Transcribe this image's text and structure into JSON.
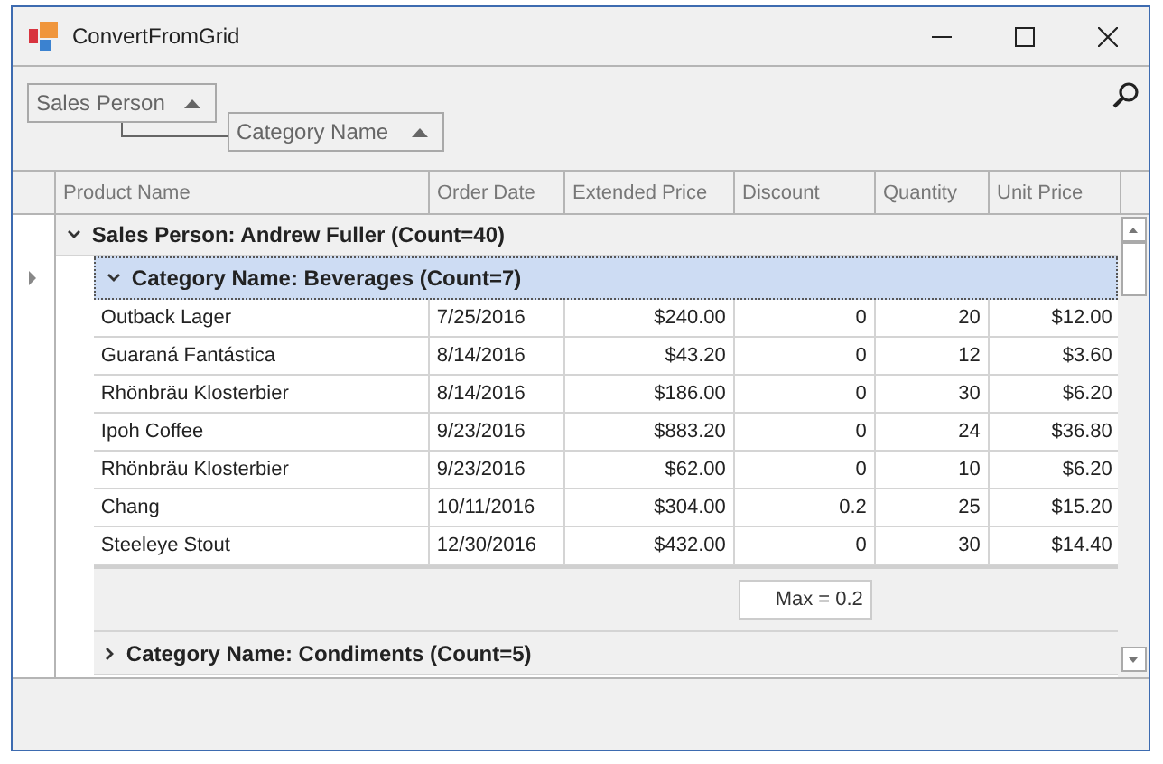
{
  "window": {
    "title": "ConvertFromGrid"
  },
  "group_panel": [
    {
      "label": "Sales Person"
    },
    {
      "label": "Category Name"
    }
  ],
  "columns": [
    {
      "label": "Product Name"
    },
    {
      "label": "Order Date"
    },
    {
      "label": "Extended Price"
    },
    {
      "label": "Discount"
    },
    {
      "label": "Quantity"
    },
    {
      "label": "Unit Price"
    }
  ],
  "groups": [
    {
      "label": "Sales Person: Andrew Fuller (Count=40)",
      "expanded": true,
      "children": [
        {
          "label": "Category Name: Beverages (Count=7)",
          "expanded": true,
          "selected": true,
          "rows": [
            [
              "Outback Lager",
              "7/25/2016",
              "$240.00",
              "0",
              "20",
              "$12.00"
            ],
            [
              "Guaraná Fantástica",
              "8/14/2016",
              "$43.20",
              "0",
              "12",
              "$3.60"
            ],
            [
              "Rhönbräu Klosterbier",
              "8/14/2016",
              "$186.00",
              "0",
              "30",
              "$6.20"
            ],
            [
              "Ipoh Coffee",
              "9/23/2016",
              "$883.20",
              "0",
              "24",
              "$36.80"
            ],
            [
              "Rhönbräu Klosterbier",
              "9/23/2016",
              "$62.00",
              "0",
              "10",
              "$6.20"
            ],
            [
              "Chang",
              "10/11/2016",
              "$304.00",
              "0.2",
              "25",
              "$15.20"
            ],
            [
              "Steeleye Stout",
              "12/30/2016",
              "$432.00",
              "0",
              "30",
              "$14.40"
            ]
          ],
          "footer": [
            {
              "kind": "blank"
            },
            {
              "kind": "blank"
            },
            {
              "kind": "blank"
            },
            {
              "kind": "summary",
              "text": "Max = 0.2"
            },
            {
              "kind": "blank"
            },
            {
              "kind": "blank"
            }
          ]
        },
        {
          "label": "Category Name: Condiments (Count=5)",
          "expanded": false,
          "selected": false
        }
      ]
    }
  ]
}
